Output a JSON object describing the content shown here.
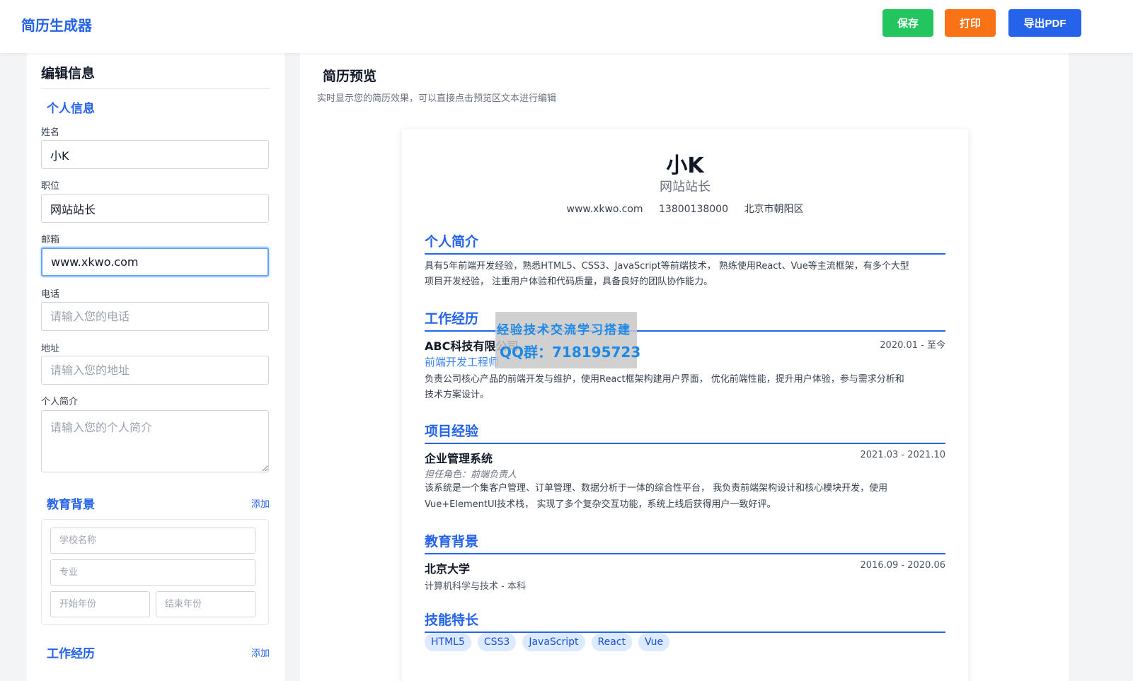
{
  "app": {
    "title": "简历生成器",
    "buttons": {
      "save": "保存",
      "print": "打印",
      "export_pdf": "导出PDF"
    },
    "colors": {
      "accent": "#2563eb",
      "save": "#22c55e",
      "print": "#f97316"
    }
  },
  "editor": {
    "title": "编辑信息",
    "personal_section": "个人信息",
    "fields": {
      "name": {
        "label": "姓名",
        "value": "小K"
      },
      "position": {
        "label": "职位",
        "value": "网站站长"
      },
      "email": {
        "label": "邮箱",
        "value": "www.xkwo.com"
      },
      "phone": {
        "label": "电话",
        "placeholder": "请输入您的电话"
      },
      "address": {
        "label": "地址",
        "placeholder": "请输入您的地址"
      },
      "summary": {
        "label": "个人简介",
        "placeholder": "请输入您的个人简介"
      }
    },
    "education": {
      "title": "教育背景",
      "add": "添加",
      "school_placeholder": "学校名称",
      "major_placeholder": "专业",
      "start_placeholder": "开始年份",
      "end_placeholder": "结束年份"
    },
    "work": {
      "title": "工作经历",
      "add": "添加"
    }
  },
  "preview": {
    "title": "简历预览",
    "subtitle": "实时显示您的简历效果，可以直接点击预览区文本进行编辑",
    "resume": {
      "name": "小K",
      "title": "网站站长",
      "contacts": [
        "www.xkwo.com",
        "13800138000",
        "北京市朝阳区"
      ],
      "summary": {
        "heading": "个人简介",
        "line1": "具有5年前端开发经验，熟悉HTML5、CSS3、JavaScript等前端技术， 熟练使用React、Vue等主流框架，有多个大型",
        "line2": "项目开发经验， 注重用户体验和代码质量，具备良好的团队协作能力。"
      },
      "work": {
        "heading": "工作经历",
        "company": "ABC科技有限公司",
        "date": "2020.01 - 至今",
        "role": "前端开发工程师",
        "line1": "负责公司核心产品的前端开发与维护，使用React框架构建用户界面， 优化前端性能，提升用户体验，参与需求分析和",
        "line2": "技术方案设计。"
      },
      "projects": {
        "heading": "项目经验",
        "name": "企业管理系统",
        "date": "2021.03 - 2021.10",
        "role": "担任角色：前端负责人",
        "line1": "该系统是一个集客户管理、订单管理、数据分析于一体的综合性平台， 我负责前端架构设计和核心模块开发，使用",
        "line2": "Vue+ElementUI技术栈， 实现了多个复杂交互功能，系统上线后获得用户一致好评。"
      },
      "education": {
        "heading": "教育背景",
        "school": "北京大学",
        "date": "2016.09 - 2020.06",
        "detail": "计算机科学与技术 - 本科"
      },
      "skills": {
        "heading": "技能特长",
        "items": [
          "HTML5",
          "CSS3",
          "JavaScript",
          "React",
          "Vue"
        ]
      }
    }
  },
  "watermark": {
    "line1": "经验技术交流学习搭建",
    "line2": "QQ群：718195723"
  }
}
